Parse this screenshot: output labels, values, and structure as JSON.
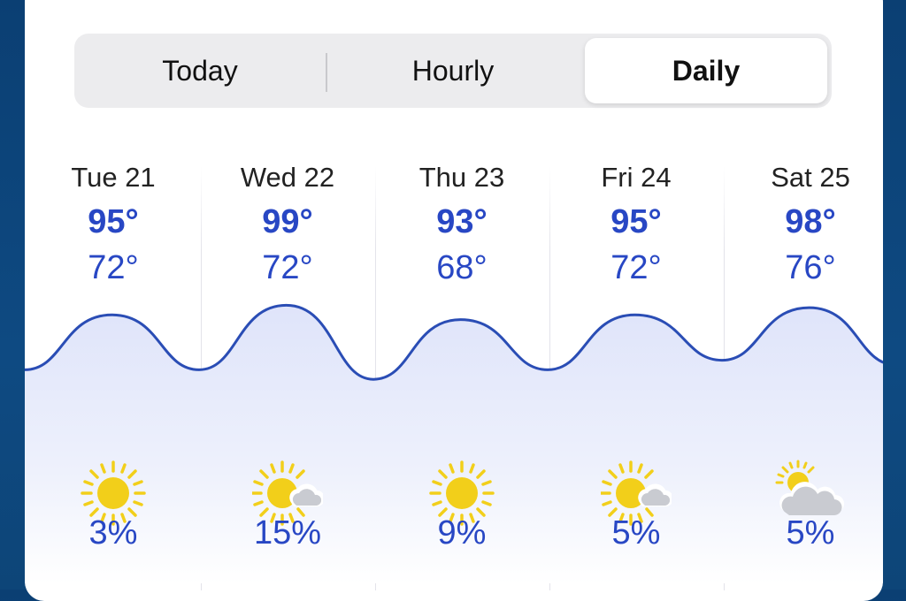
{
  "tabs": [
    {
      "label": "Today",
      "active": false
    },
    {
      "label": "Hourly",
      "active": false
    },
    {
      "label": "Daily",
      "active": true
    }
  ],
  "days": [
    {
      "label": "Tue 21",
      "high": "95°",
      "low": "72°",
      "icon": "sun-icon",
      "precip": "3%"
    },
    {
      "label": "Wed 22",
      "high": "99°",
      "low": "72°",
      "icon": "partly-sunny-icon",
      "precip": "15%"
    },
    {
      "label": "Thu 23",
      "high": "93°",
      "low": "68°",
      "icon": "sun-icon",
      "precip": "9%"
    },
    {
      "label": "Fri 24",
      "high": "95°",
      "low": "72°",
      "icon": "partly-sunny-icon",
      "precip": "5%"
    },
    {
      "label": "Sat 25",
      "high": "98°",
      "low": "76°",
      "icon": "mostly-cloudy-icon",
      "precip": "5%"
    }
  ],
  "colors": {
    "accent": "#2847c4",
    "wave_line": "#2a4db5",
    "wave_fill": "#e3e8fb",
    "sun": "#f2cf1a",
    "cloud": "#c9cbd1"
  }
}
